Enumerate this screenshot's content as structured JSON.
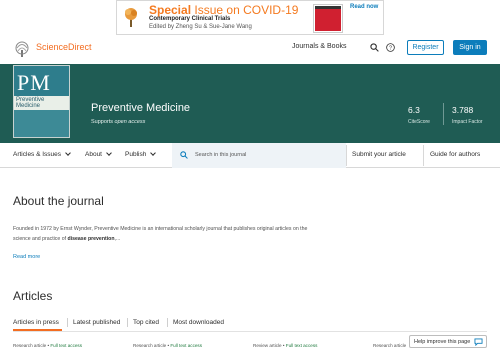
{
  "banner": {
    "title_a": "Special",
    "title_b": "Issue on COVID-19",
    "subtitle": "Contemporary Clinical Trials",
    "editors": "Edited by Zheng Su & Sue-Jane Wang",
    "cta": "Read now"
  },
  "header": {
    "brand": "ScienceDirect",
    "journals_books": "Journals & Books",
    "register": "Register",
    "sign_in": "Sign in",
    "colors": {
      "brand": "#f36d21",
      "primary": "#0c7dbb"
    }
  },
  "journal": {
    "cover_initials": "PM",
    "cover_line1": "Preventive",
    "cover_line2": "Medicine",
    "name": "Preventive Medicine",
    "access_prefix": "Supports",
    "access_type": "open access",
    "metrics": [
      {
        "value": "6.3",
        "label": "CiteScore"
      },
      {
        "value": "3.788",
        "label": "Impact Factor"
      }
    ],
    "hero_color": "#1f5c54"
  },
  "nav": {
    "articles_issues": "Articles & Issues",
    "about": "About",
    "publish": "Publish",
    "search_placeholder": "Search in this journal",
    "submit": "Submit your article",
    "guide": "Guide for authors"
  },
  "about": {
    "title": "About the journal",
    "text_1": "Founded in 1972 by Ernst Wynder, Preventive Medicine is an international scholarly journal that publishes original articles on the",
    "text_2_pre": "science and practice of ",
    "text_2_bold": "disease prevention",
    "text_2_post": ",...",
    "read_more": "Read more"
  },
  "articles": {
    "title": "Articles",
    "tabs": [
      "Articles in press",
      "Latest published",
      "Top cited",
      "Most downloaded"
    ],
    "items": [
      {
        "type": "Research article",
        "access": "Full text access"
      },
      {
        "type": "Research article",
        "access": "Full text access"
      },
      {
        "type": "Review article",
        "access": "Full text access"
      },
      {
        "type": "Research article",
        "access": ""
      }
    ]
  },
  "feedback": {
    "label": "Help improve this page"
  }
}
